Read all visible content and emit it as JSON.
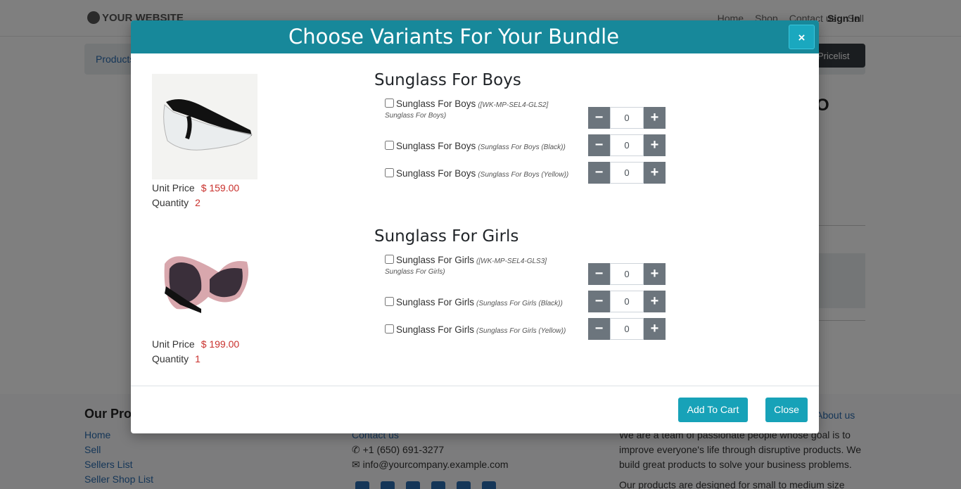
{
  "background": {
    "logo": "YOUR WEBSITE",
    "menu": [
      "Home",
      "Shop",
      "Contact us",
      "Sell"
    ],
    "signin": "Sign in",
    "products_link": "Products",
    "pricelist": "Pricelist",
    "footer": {
      "heading": "Our Products & Services",
      "links": [
        "Home",
        "Sell",
        "Sellers List",
        "Seller Shop List"
      ],
      "contact_link": "Contact us",
      "phone": "+1 (650) 691-3277",
      "email": "info@yourcompany.example.com",
      "about_heading": "About us",
      "about_text": "We are a team of passionate people whose goal is to improve everyone's life through disruptive products. We build great products to solve your business problems.",
      "about_text2": "Our products are designed for small to medium size"
    }
  },
  "modal": {
    "title": "Choose Variants For Your Bundle",
    "close_x": "×",
    "products": [
      {
        "name": "Sunglass For Boys",
        "unit_price_label": "Unit Price",
        "unit_price": "$ 159.00",
        "quantity_label": "Quantity",
        "quantity": "2",
        "variants": [
          {
            "label": "Sunglass For Boys",
            "ref": "([WK-MP-SEL4-GLS2]",
            "ref2": "Sunglass For Boys)",
            "qty": "0"
          },
          {
            "label": "Sunglass For Boys",
            "ref": "(Sunglass For Boys (Black))",
            "qty": "0"
          },
          {
            "label": "Sunglass For Boys",
            "ref": "(Sunglass For Boys (Yellow))",
            "qty": "0"
          }
        ]
      },
      {
        "name": "Sunglass For Girls",
        "unit_price_label": "Unit Price",
        "unit_price": "$ 199.00",
        "quantity_label": "Quantity",
        "quantity": "1",
        "variants": [
          {
            "label": "Sunglass For Girls",
            "ref": "([WK-MP-SEL4-GLS3]",
            "ref2": "Sunglass For Girls)",
            "qty": "0"
          },
          {
            "label": "Sunglass For Girls",
            "ref": "(Sunglass For Girls (Black))",
            "qty": "0"
          },
          {
            "label": "Sunglass For Girls",
            "ref": "(Sunglass For Girls (Yellow))",
            "qty": "0"
          }
        ]
      }
    ],
    "stepper_minus": "−",
    "stepper_plus": "+",
    "add_to_cart": "Add To Cart",
    "close": "Close"
  },
  "colors": {
    "header": "#17889a",
    "button": "#17a2b8",
    "stepper": "#6c757d",
    "price": "#c9302c"
  }
}
